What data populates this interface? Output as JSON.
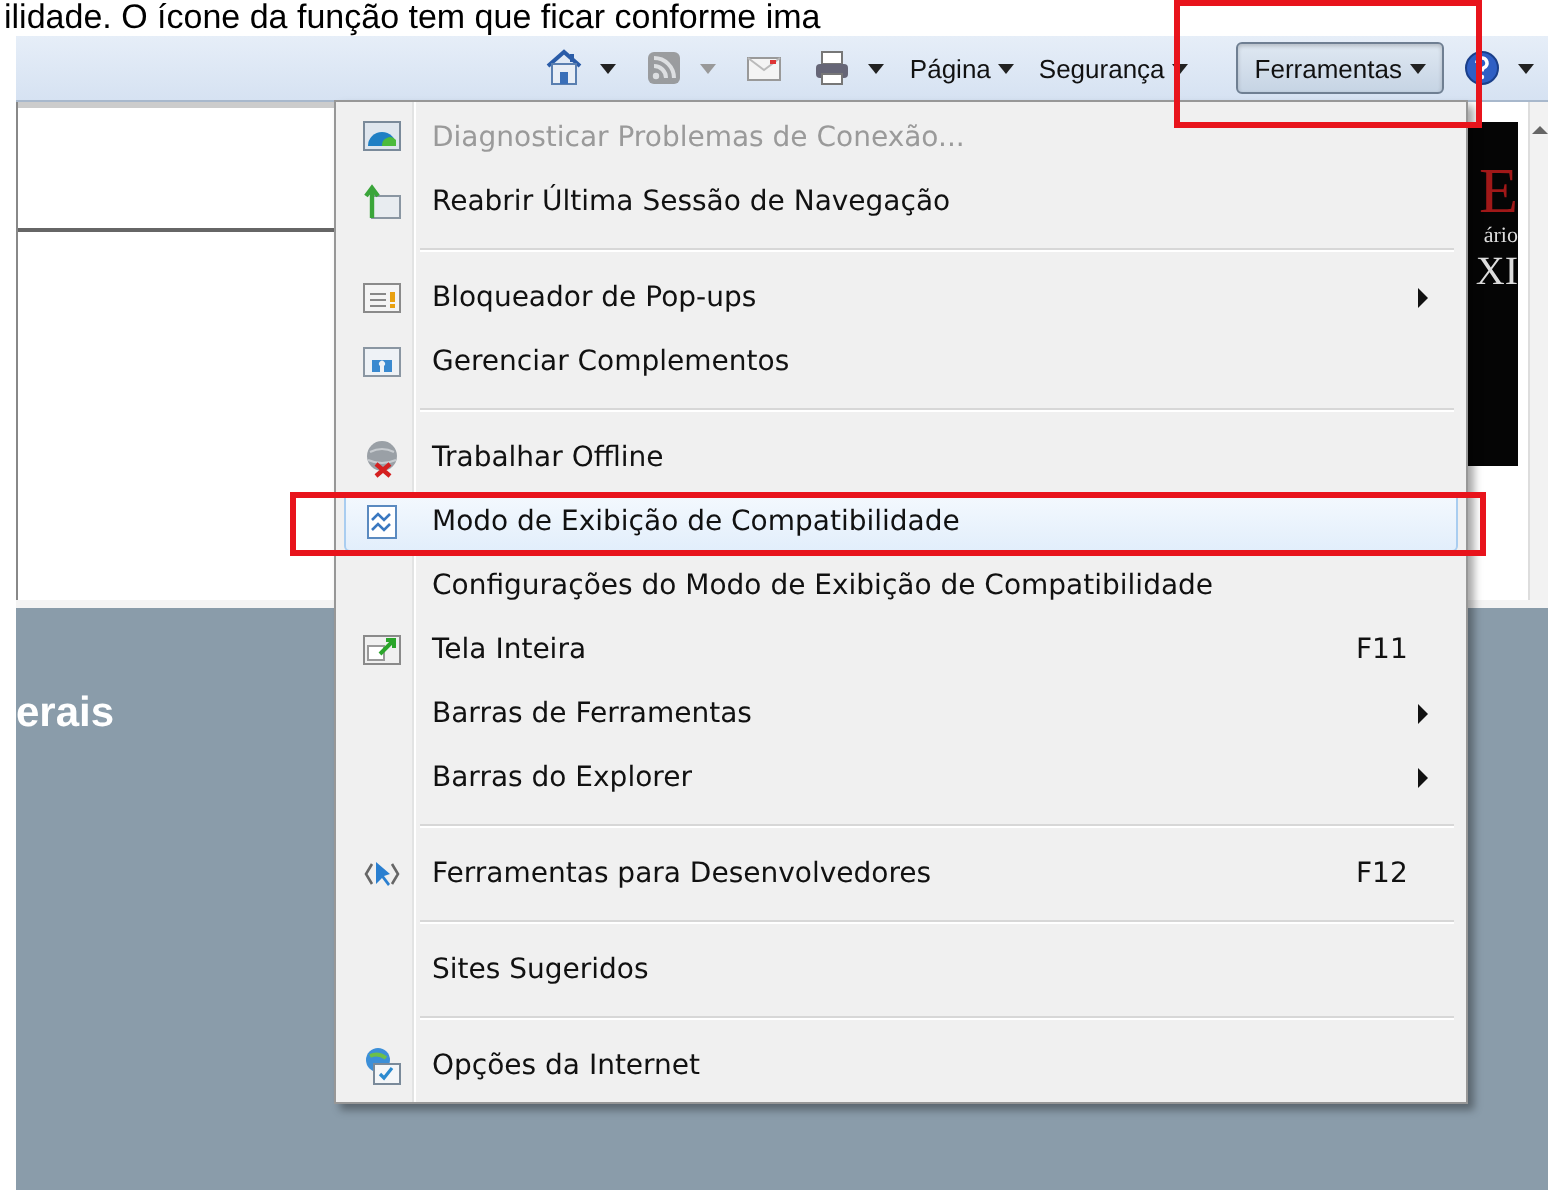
{
  "caption": "ilidade. O ícone da função tem que ficar conforme ima",
  "toolbar": {
    "buttons": [
      {
        "kind": "home",
        "dropdown": true,
        "pressed": false
      },
      {
        "kind": "feed",
        "dropdown": true,
        "pressed": false
      },
      {
        "kind": "mail",
        "dropdown": false,
        "pressed": false
      },
      {
        "kind": "print",
        "dropdown": true,
        "pressed": false
      },
      {
        "kind": "text",
        "label": "Página",
        "dropdown": true,
        "pressed": false
      },
      {
        "kind": "text",
        "label": "Segurança",
        "dropdown": true,
        "pressed": false
      },
      {
        "kind": "text",
        "label": "Ferramentas",
        "dropdown": true,
        "pressed": true
      },
      {
        "kind": "help",
        "dropdown": true,
        "pressed": false
      }
    ]
  },
  "page": {
    "banner": {
      "initial": "E",
      "subtitle": "ário",
      "numeral": "XI"
    },
    "heading": "erais"
  },
  "menu": {
    "items": [
      {
        "kind": "item",
        "label": "Diagnosticar Problemas de Conexão...",
        "submenu": false,
        "disabled": true,
        "selected": false
      },
      {
        "kind": "item",
        "label": "Reabrir Última Sessão de Navegação",
        "submenu": false,
        "disabled": false,
        "selected": false
      },
      {
        "kind": "separator"
      },
      {
        "kind": "item",
        "label": "Bloqueador de Pop-ups",
        "submenu": true,
        "disabled": false,
        "selected": false
      },
      {
        "kind": "item",
        "label": "Gerenciar Complementos",
        "submenu": false,
        "disabled": false,
        "selected": false
      },
      {
        "kind": "separator"
      },
      {
        "kind": "item",
        "label": "Trabalhar Offline",
        "submenu": false,
        "disabled": false,
        "selected": false
      },
      {
        "kind": "item",
        "label": "Modo de Exibição de Compatibilidade",
        "submenu": false,
        "disabled": false,
        "selected": true
      },
      {
        "kind": "item",
        "label": "Configurações do Modo de Exibição de Compatibilidade",
        "submenu": false,
        "disabled": false,
        "selected": false
      },
      {
        "kind": "item",
        "label": "Tela Inteira",
        "shortcut": "F11",
        "submenu": false,
        "disabled": false,
        "selected": false
      },
      {
        "kind": "item",
        "label": "Barras de Ferramentas",
        "submenu": true,
        "disabled": false,
        "selected": false
      },
      {
        "kind": "item",
        "label": "Barras do Explorer",
        "submenu": true,
        "disabled": false,
        "selected": false
      },
      {
        "kind": "separator"
      },
      {
        "kind": "item",
        "label": "Ferramentas para Desenvolvedores",
        "shortcut": "F12",
        "submenu": false,
        "disabled": false,
        "selected": false
      },
      {
        "kind": "separator"
      },
      {
        "kind": "item",
        "label": "Sites Sugeridos",
        "submenu": false,
        "disabled": false,
        "selected": false
      },
      {
        "kind": "separator"
      },
      {
        "kind": "item",
        "label": "Opções da Internet",
        "submenu": false,
        "disabled": false,
        "selected": false
      }
    ]
  }
}
